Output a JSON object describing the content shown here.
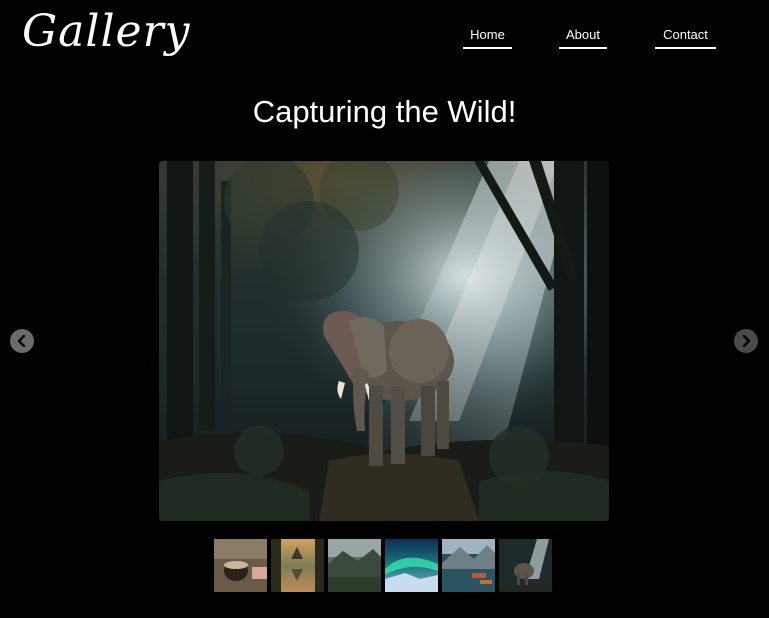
{
  "header": {
    "logo": "Gallery",
    "nav": [
      {
        "label": "Home"
      },
      {
        "label": "About"
      },
      {
        "label": "Contact"
      }
    ]
  },
  "main": {
    "title": "Capturing the Wild!"
  },
  "carousel": {
    "prev_icon": "chevron-left-icon",
    "next_icon": "chevron-right-icon",
    "current_image": "elephant-in-forest",
    "thumbnails": [
      "coffee-mug",
      "tree-lake-reflection",
      "mountain-forest",
      "aurora-borealis",
      "mountain-lake-boats",
      "elephant-in-forest"
    ]
  }
}
